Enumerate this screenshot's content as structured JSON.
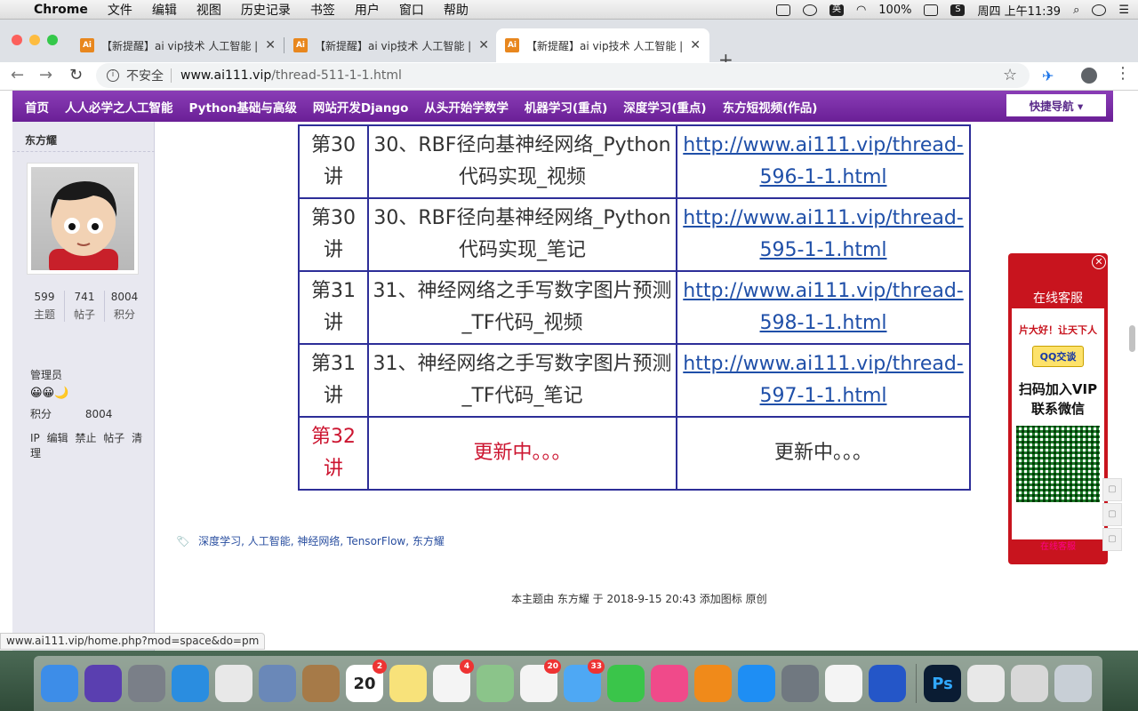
{
  "menubar": {
    "app": "Chrome",
    "items": [
      "文件",
      "编辑",
      "视图",
      "历史记录",
      "书签",
      "用户",
      "窗口",
      "帮助"
    ],
    "input_method": "英",
    "battery": "100%",
    "clock": "周四 上午11:39"
  },
  "tabs": [
    {
      "label": "【新提醒】ai vip技术 人工智能 |",
      "favicon": "Ai"
    },
    {
      "label": "【新提醒】ai vip技术 人工智能 |",
      "favicon": "Ai"
    },
    {
      "label": "【新提醒】ai vip技术 人工智能 |",
      "favicon": "Ai"
    }
  ],
  "address": {
    "security": "不安全",
    "host": "www.ai111.vip",
    "path": "/thread-511-1-1.html"
  },
  "site_nav": {
    "items": [
      "首页",
      "人人必学之人工智能",
      "Python基础与高级",
      "网站开发Django",
      "从头开始学数学",
      "机器学习(重点)",
      "深度学习(重点)",
      "东方短视频(作品)"
    ],
    "quick_nav": "快捷导航 ▾"
  },
  "profile": {
    "username": "东方耀",
    "stats": [
      {
        "value": "599",
        "label": "主题"
      },
      {
        "value": "741",
        "label": "帖子"
      },
      {
        "value": "8004",
        "label": "积分"
      }
    ],
    "role": "管理员",
    "credits_label": "积分",
    "credits_value": "8004",
    "admin_links": [
      "IP",
      "编辑",
      "禁止",
      "帖子",
      "清理"
    ]
  },
  "lessons": [
    {
      "num": "第30讲",
      "title": "30、RBF径向基神经网络_Python代码实现_视频",
      "link": "http://www.ai111.vip/thread-596-1-1.html"
    },
    {
      "num": "第30讲",
      "title": "30、RBF径向基神经网络_Python代码实现_笔记",
      "link": "http://www.ai111.vip/thread-595-1-1.html"
    },
    {
      "num": "第31讲",
      "title": "31、神经网络之手写数字图片预测_TF代码_视频",
      "link": "http://www.ai111.vip/thread-598-1-1.html"
    },
    {
      "num": "第31讲",
      "title": "31、神经网络之手写数字图片预测_TF代码_笔记",
      "link": "http://www.ai111.vip/thread-597-1-1.html"
    },
    {
      "num": "第32讲",
      "title": "更新中。。。",
      "link": "更新中。。。"
    }
  ],
  "tags": [
    "深度学习",
    "人工智能",
    "神经网络",
    "TensorFlow",
    "东方耀"
  ],
  "post_info": "本主题由 东方耀 于 2018-9-15 20:43 添加图标 原创",
  "ad": {
    "service": "在线客服",
    "marquee": "片大好！让天下人",
    "qq_button": "QQ交谈",
    "title_line1": "扫码加入VIP",
    "title_line2": "联系微信",
    "bottom": "在线客服"
  },
  "status_url": "www.ai111.vip/home.php?mod=space&do=pm",
  "dock": [
    {
      "name": "finder",
      "color": "#3d8de8"
    },
    {
      "name": "siri",
      "color": "#5a3fb0"
    },
    {
      "name": "launchpad",
      "color": "#7a7f88"
    },
    {
      "name": "safari",
      "color": "#2a8de0"
    },
    {
      "name": "chrome",
      "color": "#e8e8e8"
    },
    {
      "name": "mail-bird",
      "color": "#6a88b8"
    },
    {
      "name": "contacts",
      "color": "#a67a48"
    },
    {
      "name": "calendar",
      "color": "#ffffff",
      "text": "20",
      "badge": "2"
    },
    {
      "name": "notes",
      "color": "#f8e27a"
    },
    {
      "name": "reminders",
      "color": "#f4f4f4",
      "badge": "4"
    },
    {
      "name": "maps",
      "color": "#8bc48a"
    },
    {
      "name": "photos",
      "color": "#f4f4f4",
      "badge": "20"
    },
    {
      "name": "messages",
      "color": "#4ea8f4",
      "badge": "33"
    },
    {
      "name": "facetime",
      "color": "#3ac54a"
    },
    {
      "name": "itunes",
      "color": "#f04a8a"
    },
    {
      "name": "ibooks",
      "color": "#f08a1a"
    },
    {
      "name": "app-store",
      "color": "#1e8ef4"
    },
    {
      "name": "system-preferences",
      "color": "#707880"
    },
    {
      "name": "textedit",
      "color": "#f4f4f4"
    },
    {
      "name": "screenflow",
      "color": "#2456c8"
    },
    {
      "name": "photoshop",
      "color": "#0a1c33",
      "text": "Ps"
    },
    {
      "name": "documents",
      "color": "#e8e8e8"
    },
    {
      "name": "preview-ps",
      "color": "#d8d8d8"
    },
    {
      "name": "trash",
      "color": "#c8cfd6"
    }
  ]
}
